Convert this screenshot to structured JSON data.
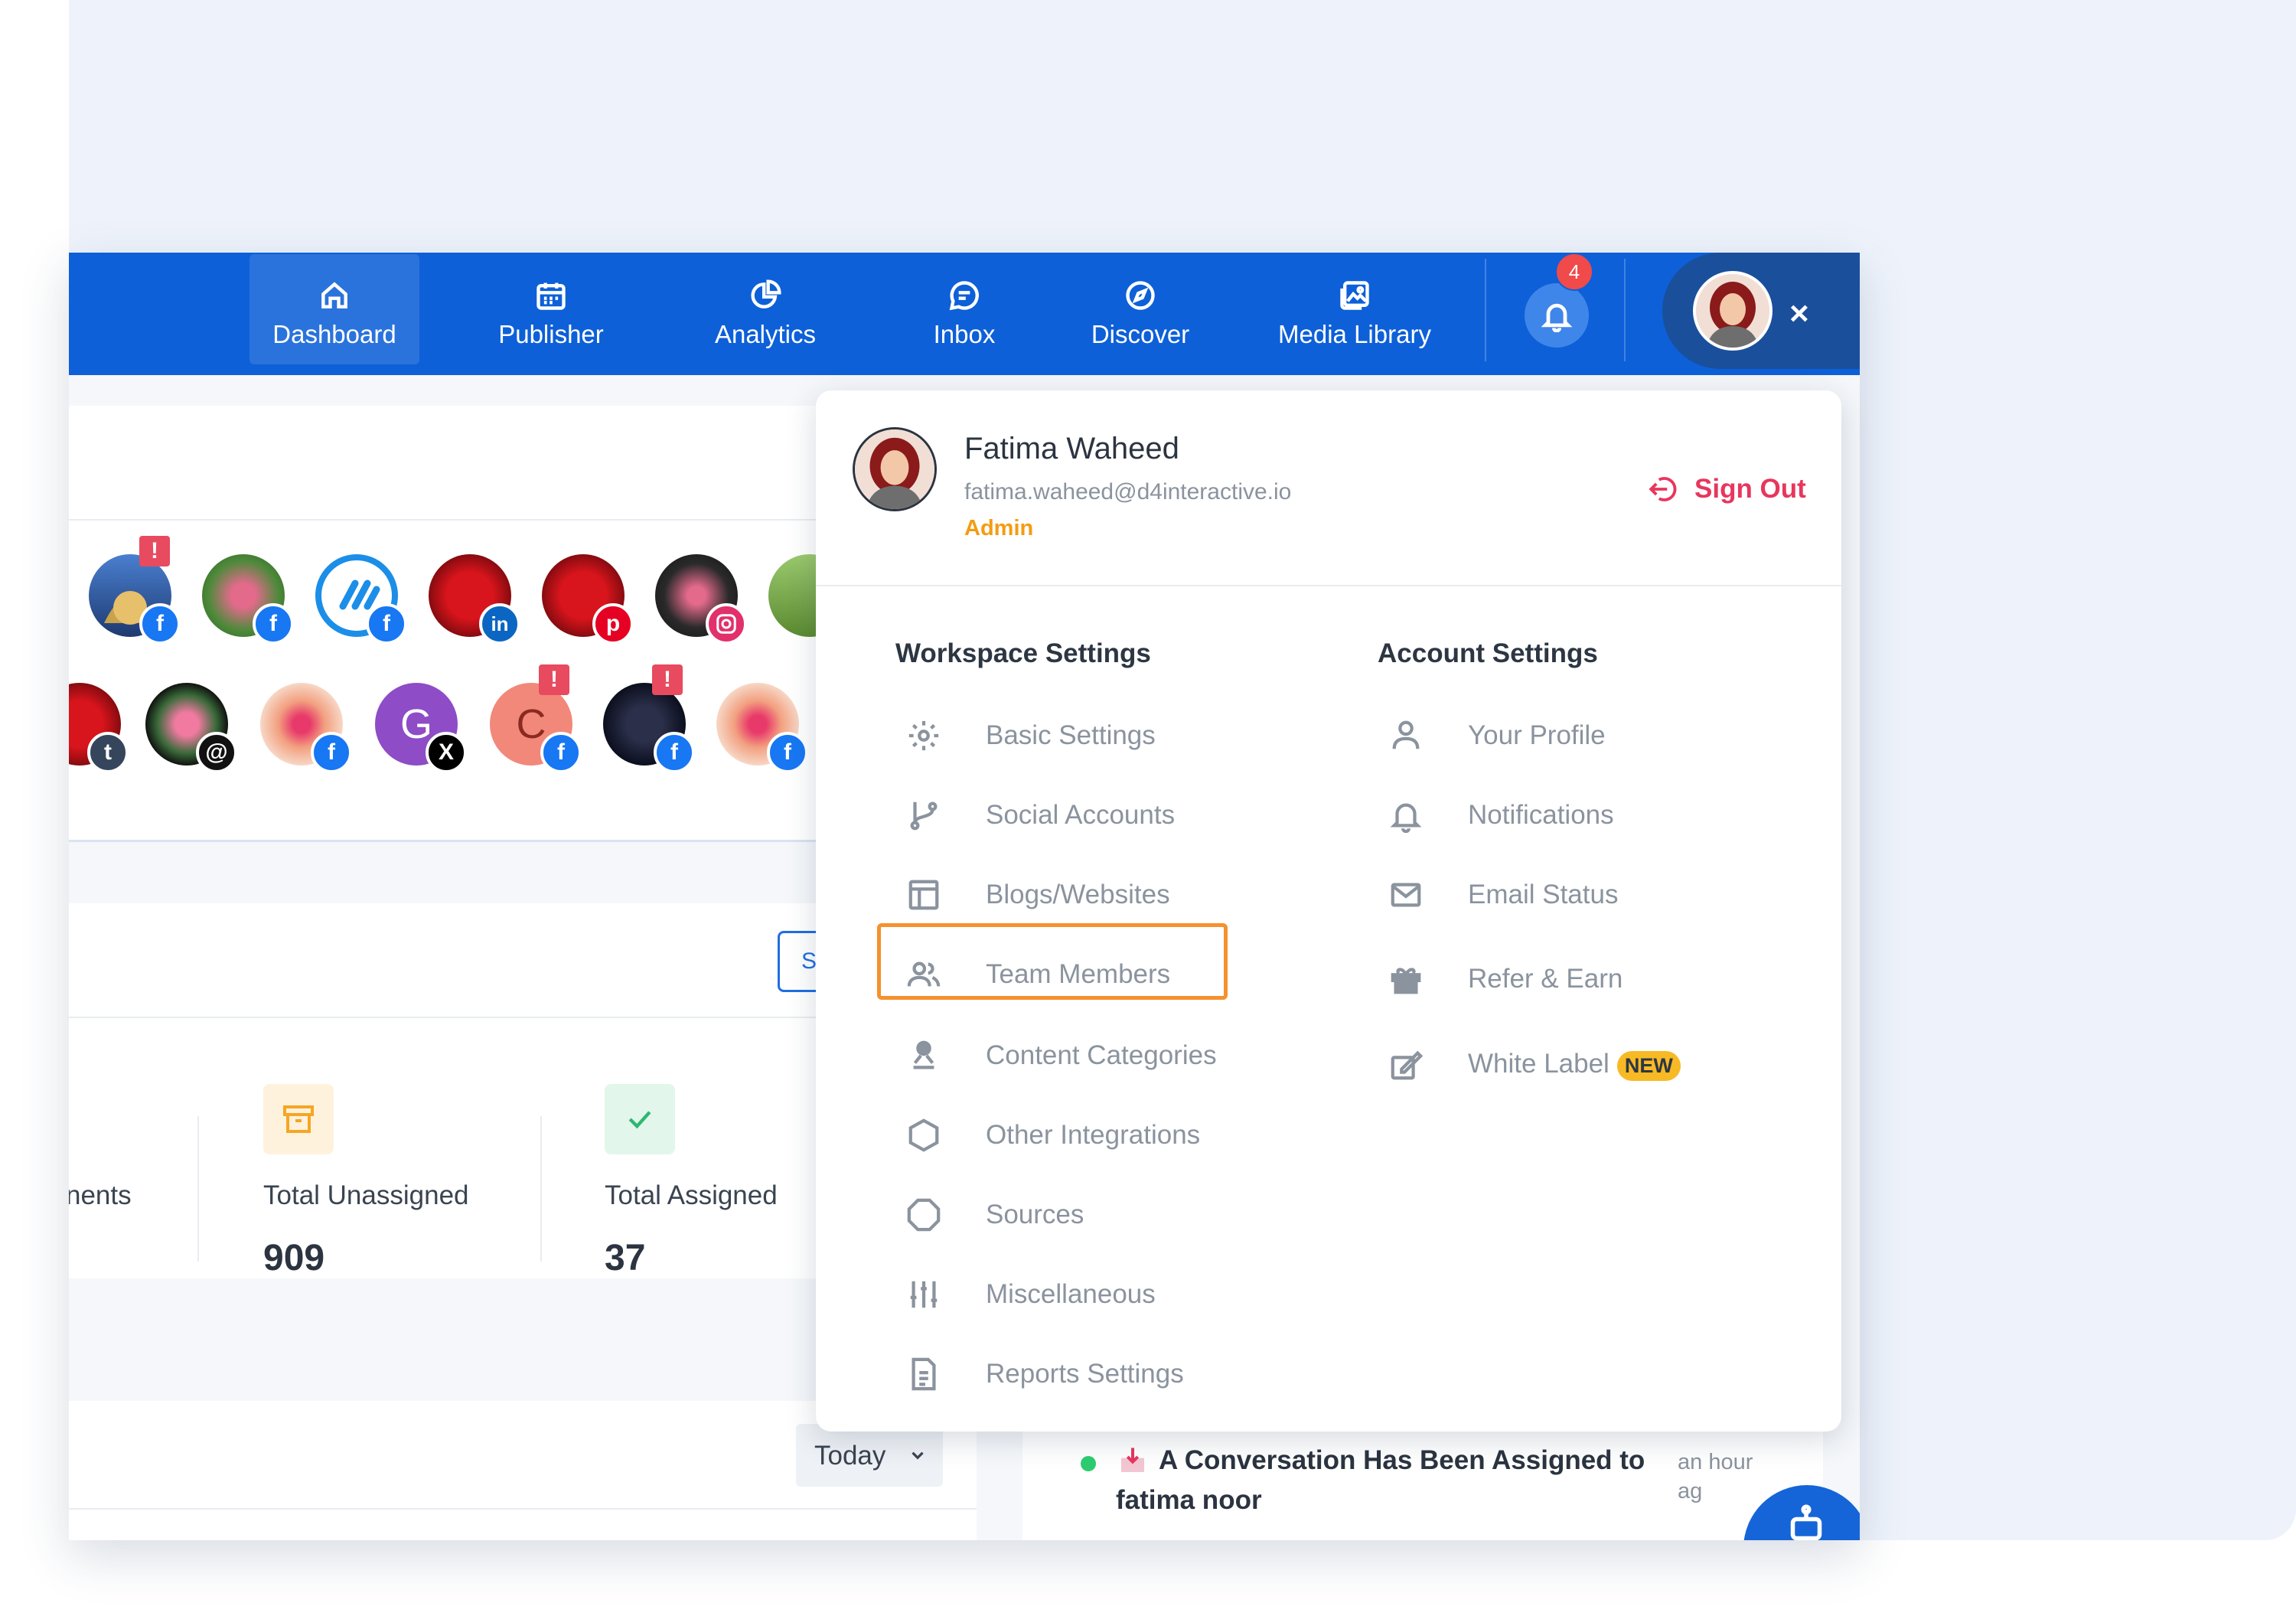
{
  "nav": {
    "items": [
      {
        "label": "Dashboard",
        "icon": "home-icon"
      },
      {
        "label": "Publisher",
        "icon": "calendar-icon"
      },
      {
        "label": "Analytics",
        "icon": "pie-chart-icon"
      },
      {
        "label": "Inbox",
        "icon": "chat-icon"
      },
      {
        "label": "Discover",
        "icon": "compass-icon"
      },
      {
        "label": "Media Library",
        "icon": "image-icon"
      }
    ],
    "notification_count": "4",
    "close_label": "×"
  },
  "profile": {
    "name": "Fatima Waheed",
    "email": "fatima.waheed@d4interactive.io",
    "role": "Admin",
    "sign_out": "Sign Out"
  },
  "workspace": {
    "title": "Workspace Settings",
    "items": [
      {
        "label": "Basic Settings",
        "icon": "gear-icon"
      },
      {
        "label": "Social Accounts",
        "icon": "branch-icon"
      },
      {
        "label": "Blogs/Websites",
        "icon": "layout-icon"
      },
      {
        "label": "Team Members",
        "icon": "users-icon"
      },
      {
        "label": "Content Categories",
        "icon": "person-stamp-icon"
      },
      {
        "label": "Other Integrations",
        "icon": "hexagon-icon"
      },
      {
        "label": "Sources",
        "icon": "octagon-icon"
      },
      {
        "label": "Miscellaneous",
        "icon": "sliders-icon"
      },
      {
        "label": "Reports Settings",
        "icon": "document-icon"
      }
    ]
  },
  "account": {
    "title": "Account Settings",
    "items": [
      {
        "label": "Your Profile",
        "icon": "user-icon"
      },
      {
        "label": "Notifications",
        "icon": "bell-icon"
      },
      {
        "label": "Email Status",
        "icon": "mail-icon"
      },
      {
        "label": "Refer & Earn",
        "icon": "gift-icon"
      },
      {
        "label": "White Label",
        "icon": "edit-icon",
        "badge": "NEW"
      }
    ]
  },
  "stats": {
    "partial_label": "nents",
    "unassigned_label": "Total Unassigned",
    "unassigned_value": "909",
    "assigned_label": "Total Assigned",
    "assigned_value": "37"
  },
  "filter": {
    "selected": "Today"
  },
  "partial_button": "S",
  "avatar_letters": {
    "g": "G",
    "c": "C"
  },
  "alert_mark": "!",
  "activity": {
    "title_line1": "A Conversation Has Been Assigned to",
    "title_line2": "fatima noor",
    "time_line1": "an hour",
    "time_line2": "ag"
  },
  "colors": {
    "brand": "#0d60d8",
    "highlight": "#f5912e",
    "signout": "#e8365d",
    "role": "#f39c12"
  }
}
